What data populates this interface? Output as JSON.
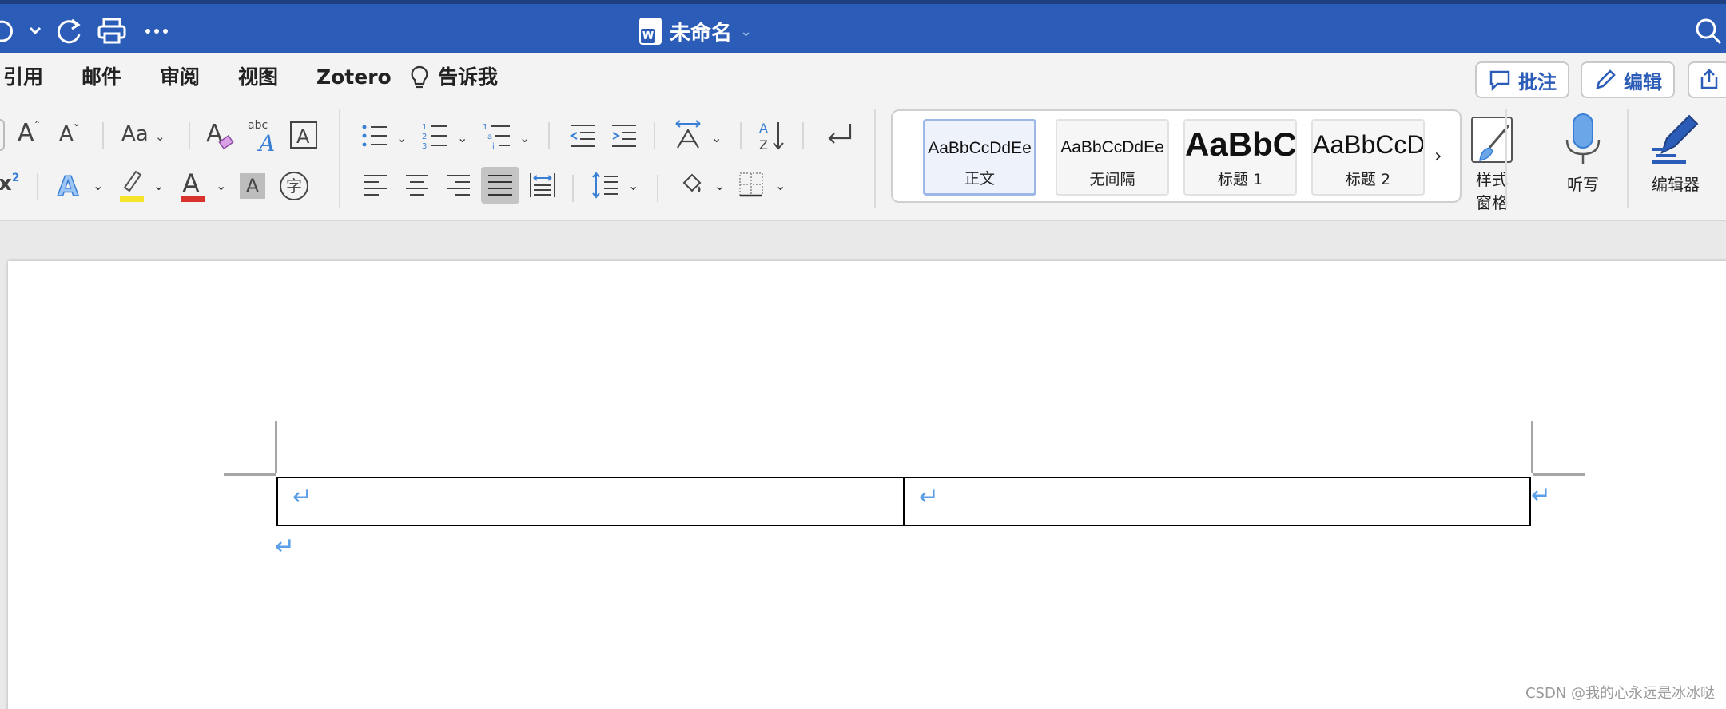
{
  "window": {
    "doc_title": "未命名",
    "icons": [
      "undo-icon",
      "redo-icon",
      "print-icon",
      "more-icon",
      "search-icon"
    ]
  },
  "tabs": {
    "references": "引用",
    "mailings": "邮件",
    "review": "审阅",
    "view": "视图",
    "zotero": "Zotero",
    "tell_me": "告诉我",
    "comments_button": "批注",
    "editing_button": "编辑"
  },
  "ribbon": {
    "superscript_partial": "x",
    "grow_font": "A",
    "shrink_font": "A",
    "change_case": "Aa",
    "text_effects": "A",
    "font_color": "A",
    "char_shading": "A",
    "enclose_char": "字",
    "colors": {
      "accent": "#2b5cb7",
      "highlight": "#f5e42a",
      "font_color": "#d9312b",
      "paragraph_mark": "#5a9ee8"
    },
    "styles": [
      {
        "sample": "AaBbCcDdEe",
        "label": "正文",
        "selected": true
      },
      {
        "sample": "AaBbCcDdEe",
        "label": "无间隔",
        "selected": false
      },
      {
        "sample": "AaBbC",
        "label": "标题 1",
        "selected": false
      },
      {
        "sample": "AaBbCcD",
        "label": "标题 2",
        "selected": false
      }
    ],
    "styles_pane_line1": "样式",
    "styles_pane_line2": "窗格",
    "dictate": "听写",
    "editor": "编辑器"
  },
  "document": {
    "paragraph_mark": "↵",
    "watermark": "CSDN @我的心永远是冰冰哒"
  }
}
